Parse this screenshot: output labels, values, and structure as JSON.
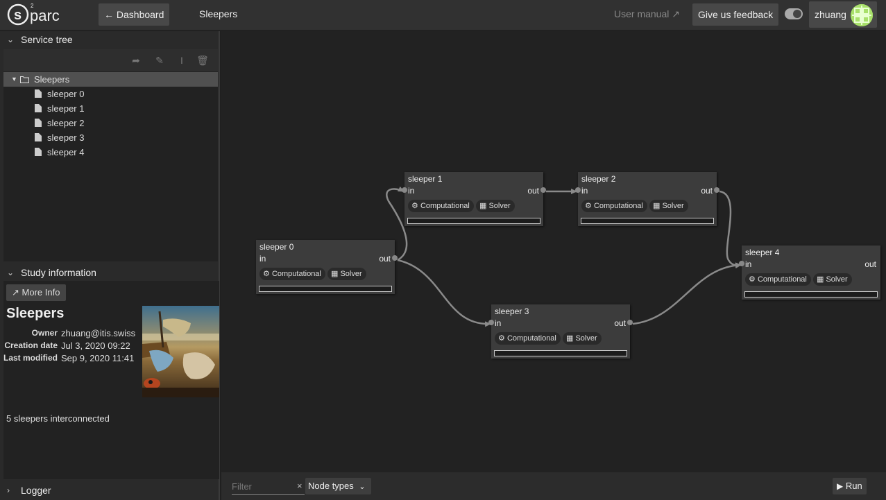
{
  "header": {
    "logo_text": "s2parc",
    "dashboard_label": "Dashboard",
    "study_title": "Sleepers",
    "user_manual": "User manual",
    "feedback": "Give us feedback",
    "username": "zhuang"
  },
  "sidebar": {
    "service_tree_title": "Service tree",
    "tree": {
      "root": "Sleepers",
      "children": [
        "sleeper 0",
        "sleeper 1",
        "sleeper 2",
        "sleeper 3",
        "sleeper 4"
      ]
    },
    "study_info_title": "Study information",
    "more_info": "More Info",
    "study": {
      "name": "Sleepers",
      "owner_label": "Owner",
      "owner": "zhuang@itis.swiss",
      "created_label": "Creation date",
      "created": "Jul 3, 2020 09:22",
      "modified_label": "Last modified",
      "modified": "Sep 9, 2020 11:41",
      "description": "5 sleepers interconnected"
    },
    "logger_title": "Logger"
  },
  "nodes": [
    {
      "title": "sleeper 0",
      "in": "in",
      "out": "out",
      "type": "Computational",
      "kind": "Solver"
    },
    {
      "title": "sleeper 1",
      "in": "in",
      "out": "out",
      "type": "Computational",
      "kind": "Solver"
    },
    {
      "title": "sleeper 2",
      "in": "in",
      "out": "out",
      "type": "Computational",
      "kind": "Solver"
    },
    {
      "title": "sleeper 3",
      "in": "in",
      "out": "out",
      "type": "Computational",
      "kind": "Solver"
    },
    {
      "title": "sleeper 4",
      "in": "in",
      "out": "out",
      "type": "Computational",
      "kind": "Solver"
    }
  ],
  "bottombar": {
    "filter_placeholder": "Filter",
    "node_types": "Node types",
    "run": "Run"
  },
  "colors": {
    "background": "#202020",
    "node": "#3c3c3c",
    "edge": "#8a8a8a",
    "button": "#484848"
  }
}
